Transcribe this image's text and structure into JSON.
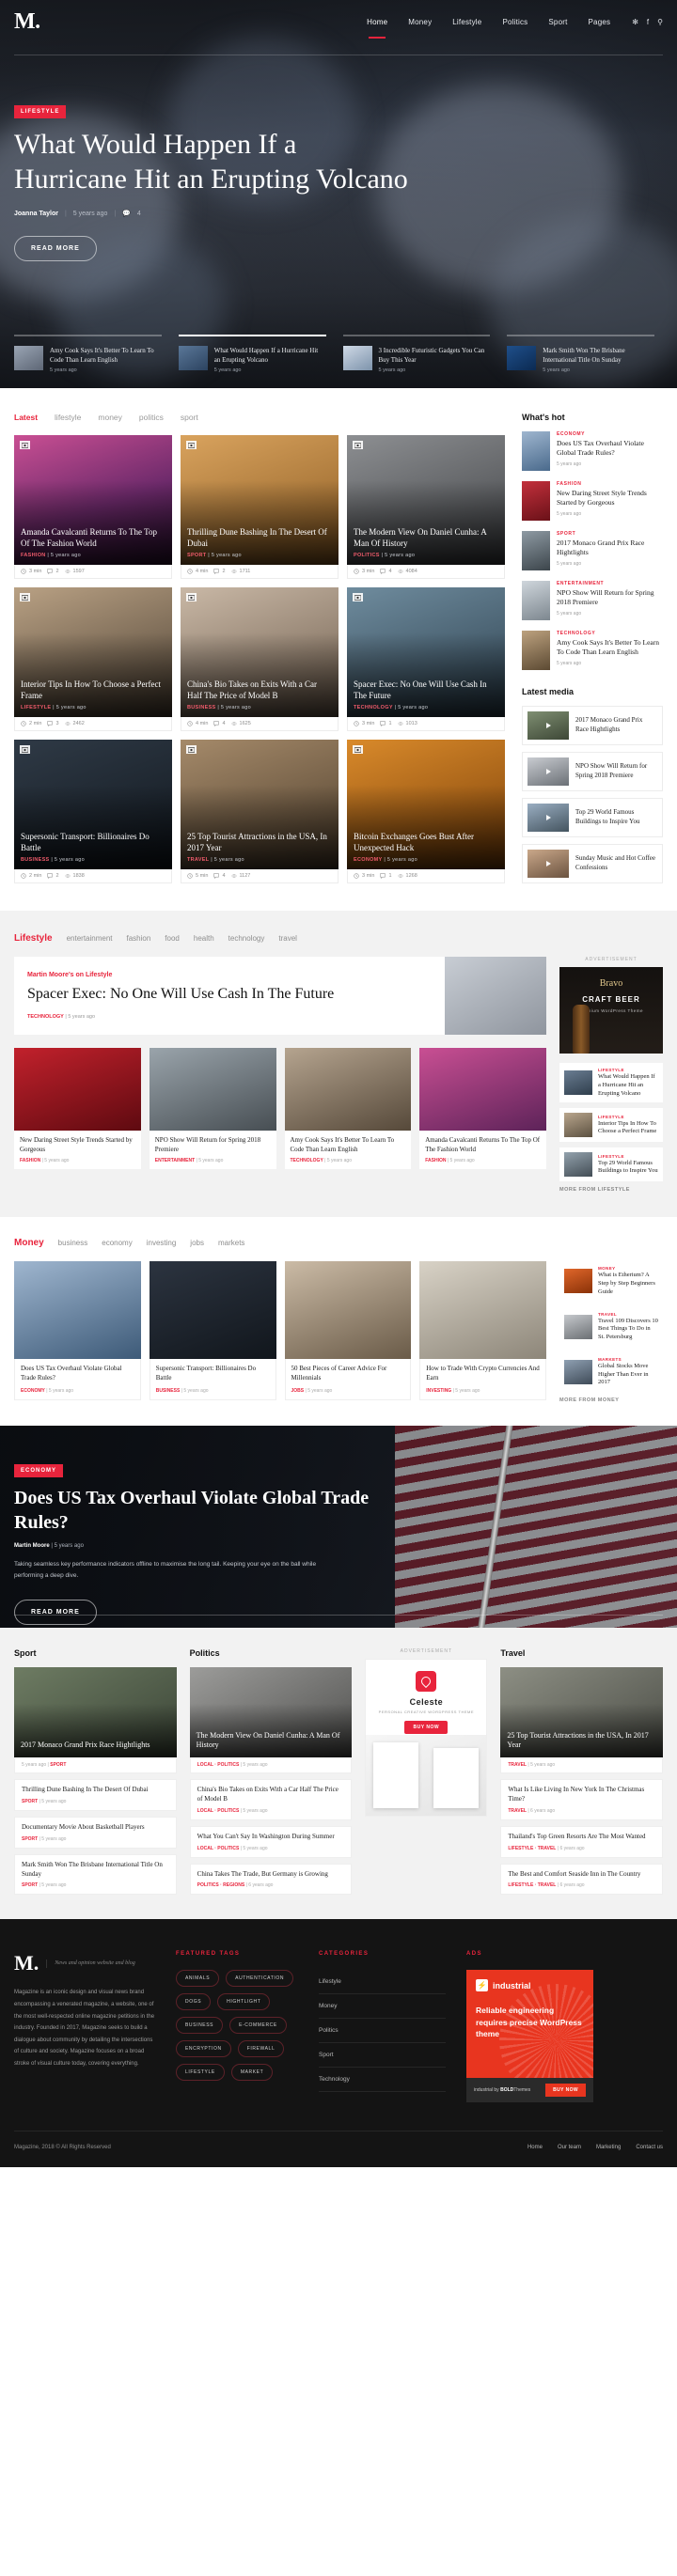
{
  "site": {
    "logo": "M.",
    "nav": [
      {
        "label": "Home",
        "active": true
      },
      {
        "label": "Money",
        "active": false
      },
      {
        "label": "Lifestyle",
        "active": false
      },
      {
        "label": "Politics",
        "active": false
      },
      {
        "label": "Sport",
        "active": false
      },
      {
        "label": "Pages",
        "active": false
      }
    ],
    "icons": [
      "twitter-icon",
      "facebook-icon",
      "search-icon"
    ],
    "accent": "#e8243c"
  },
  "hero": {
    "category": "LIFESTYLE",
    "title": "What Would Happen If a Hurricane Hit an Erupting Volcano",
    "author": "Joanna Taylor",
    "time": "5 years ago",
    "comments": "4",
    "cta": "READ MORE",
    "strip": [
      {
        "title": "Amy Cook Says It's Better To Learn To Code Than Learn English",
        "time": "5 years ago",
        "active": false
      },
      {
        "title": "What Would Happen If a Hurricane Hit an Erupting Volcano",
        "time": "5 years ago",
        "active": true
      },
      {
        "title": "3 Incredible Futuristic Gadgets You Can Buy This Year",
        "time": "5 years ago",
        "active": false
      },
      {
        "title": "Mark Smith Won The Brisbane International Title On Sunday",
        "time": "5 years ago",
        "active": false
      }
    ]
  },
  "latest": {
    "tabs": [
      {
        "label": "Latest",
        "active": true
      },
      {
        "label": "lifestyle",
        "active": false
      },
      {
        "label": "money",
        "active": false
      },
      {
        "label": "politics",
        "active": false
      },
      {
        "label": "sport",
        "active": false
      }
    ],
    "cards": [
      {
        "title": "Amanda Cavalcanti Returns To The Top Of The Fashion World",
        "cat": "FASHION",
        "time": "5 years ago",
        "read": "3 min",
        "comments": "2",
        "views": "1597"
      },
      {
        "title": "Thrilling Dune Bashing In The Desert Of Dubai",
        "cat": "SPORT",
        "time": "5 years ago",
        "read": "4 min",
        "comments": "2",
        "views": "1711"
      },
      {
        "title": "The Modern View On Daniel Cunha: A Man Of History",
        "cat": "POLITICS",
        "time": "5 years ago",
        "read": "3 min",
        "comments": "4",
        "views": "4084"
      },
      {
        "title": "Interior Tips In How To Choose a Perfect Frame",
        "cat": "LIFESTYLE",
        "time": "5 years ago",
        "read": "2 min",
        "comments": "3",
        "views": "2462"
      },
      {
        "title": "China's Bio Takes on Exits With a Car Half The Price of Model B",
        "cat": "BUSINESS",
        "time": "5 years ago",
        "read": "4 min",
        "comments": "4",
        "views": "1625"
      },
      {
        "title": "Spacer Exec: No One Will Use Cash In The Future",
        "cat": "TECHNOLOGY",
        "time": "5 years ago",
        "read": "3 min",
        "comments": "1",
        "views": "1013"
      },
      {
        "title": "Supersonic Transport: Billionaires Do Battle",
        "cat": "BUSINESS",
        "time": "5 years ago",
        "read": "2 min",
        "comments": "2",
        "views": "1838"
      },
      {
        "title": "25 Top Tourist Attractions in the USA, In 2017 Year",
        "cat": "TRAVEL",
        "time": "5 years ago",
        "read": "5 min",
        "comments": "4",
        "views": "1127"
      },
      {
        "title": "Bitcoin Exchanges Goes Bust After Unexpected Hack",
        "cat": "ECONOMY",
        "time": "5 years ago",
        "read": "3 min",
        "comments": "1",
        "views": "1268"
      }
    ],
    "whats_hot_title": "What's hot",
    "whats_hot": [
      {
        "cat": "ECONOMY",
        "title": "Does US Tax Overhaul Violate Global Trade Rules?",
        "time": "5 years ago"
      },
      {
        "cat": "FASHION",
        "title": "New Daring Street Style Trends Started by Gorgeous",
        "time": "5 years ago"
      },
      {
        "cat": "SPORT",
        "title": "2017 Monaco Grand Prix Race Hightlights",
        "time": "5 years ago"
      },
      {
        "cat": "ENTERTAINMENT",
        "title": "NPO Show Will Return for Spring 2018 Premiere",
        "time": "5 years ago"
      },
      {
        "cat": "TECHNOLOGY",
        "title": "Amy Cook Says It's Better To Learn To Code Than Learn English",
        "time": "5 years ago"
      }
    ],
    "latest_media_title": "Latest media",
    "latest_media": [
      {
        "title": "2017 Monaco Grand Prix Race Hightlights"
      },
      {
        "title": "NPO Show Will Return for Spring 2018 Premiere"
      },
      {
        "title": "Top 29 World Famous Buildings to Inspire You"
      },
      {
        "title": "Sunday Music and Hot Coffee Confessions"
      }
    ]
  },
  "lifestyle": {
    "section": "Lifestyle",
    "tabs": [
      "entertainment",
      "fashion",
      "food",
      "health",
      "technology",
      "travel"
    ],
    "feature": {
      "kicker": "Martin Moore's on Lifestyle",
      "title": "Spacer Exec: No One Will Use Cash In The Future",
      "cat": "TECHNOLOGY",
      "time": "5 years ago"
    },
    "ad_label": "ADVERTISEMENT",
    "ad": {
      "brand": "Bravo",
      "line1": "CRAFT BEER",
      "line2": "Premium WordPress Theme"
    },
    "minis": [
      {
        "title": "New Daring Street Style Trends Started by Gorgeous",
        "cat": "FASHION",
        "time": "5 years ago"
      },
      {
        "title": "NPO Show Will Return for Spring 2018 Premiere",
        "cat": "ENTERTAINMENT",
        "time": "5 years ago"
      },
      {
        "title": "Amy Cook Says It's Better To Learn To Code Than Learn English",
        "cat": "TECHNOLOGY",
        "time": "5 years ago"
      },
      {
        "title": "Amanda Cavalcanti Returns To The Top Of The Fashion World",
        "cat": "FASHION",
        "time": "5 years ago"
      }
    ],
    "side": [
      {
        "cat": "LIFESTYLE",
        "title": "What Would Happen If a Hurricane Hit an Erupting Volcano"
      },
      {
        "cat": "LIFESTYLE",
        "title": "Interior Tips In How To Choose a Perfect Frame"
      },
      {
        "cat": "LIFESTYLE",
        "title": "Top 29 World Famous Buildings to Inspire You"
      }
    ],
    "more": "MORE FROM LIFESTYLE"
  },
  "money": {
    "section": "Money",
    "tabs": [
      "business",
      "economy",
      "investing",
      "jobs",
      "markets"
    ],
    "cards": [
      {
        "title": "Does US Tax Overhaul Violate Global Trade Rules?",
        "cat": "ECONOMY",
        "time": "5 years ago"
      },
      {
        "title": "Supersonic Transport: Billionaires Do Battle",
        "cat": "BUSINESS",
        "time": "5 years ago"
      },
      {
        "title": "50 Best Pieces of Career Advice For Millennials",
        "cat": "JOBS",
        "time": "5 years ago"
      },
      {
        "title": "How to Trade With Crypto Currencies And Earn",
        "cat": "INVESTING",
        "time": "5 years ago"
      }
    ],
    "side": [
      {
        "cat": "MONEY",
        "title": "What is Etherium? A Step by Step Beginners Guide"
      },
      {
        "cat": "TRAVEL",
        "title": "Travel 109 Discovers 10 Best Things To Do in St. Petersburg"
      },
      {
        "cat": "MARKETS",
        "title": "Global Stocks Move Higher Than Ever in 2017"
      }
    ],
    "more": "MORE FROM MONEY"
  },
  "dark_feature": {
    "category": "ECONOMY",
    "title": "Does US Tax Overhaul Violate Global Trade Rules?",
    "author": "Martin Moore",
    "time": "5 years ago",
    "excerpt": "Taking seamless key performance indicators offline to maximise the long tail. Keeping your eye on the ball while performing a deep dive.",
    "cta": "READ MORE"
  },
  "bottom": {
    "sport": {
      "title": "Sport",
      "lead": {
        "title": "2017 Monaco Grand Prix Race Hightlights",
        "cat": "SPORT",
        "time": "5 years ago"
      },
      "items": [
        {
          "title": "Thrilling Dune Bashing In The Desert Of Dubai",
          "cat": "SPORT",
          "time": "5 years ago"
        },
        {
          "title": "Documentary Movie About Basketball Players",
          "cat": "SPORT",
          "time": "5 years ago"
        },
        {
          "title": "Mark Smith Won The Brisbane International Title On Sunday",
          "cat": "SPORT",
          "time": "5 years ago"
        }
      ]
    },
    "politics": {
      "title": "Politics",
      "lead": {
        "title": "The Modern View On Daniel Cunha: A Man Of History",
        "cat": "LOCAL · POLITICS",
        "time": "5 years ago"
      },
      "items": [
        {
          "title": "China's Bio Takes on Exits With a Car Half The Price of Model B",
          "cat": "LOCAL · POLITICS",
          "time": "5 years ago"
        },
        {
          "title": "What You Can't Say In Washington During Summer",
          "cat": "LOCAL · POLITICS",
          "time": "5 years ago"
        },
        {
          "title": "China Takes The Trade, But Germany is Growing",
          "cat": "POLITICS · REGIONS",
          "time": "6 years ago"
        }
      ]
    },
    "ads": {
      "label": "ADVERTISEMENT",
      "brand": "Celeste",
      "sub": "PERSONAL CREATIVE WORDPRESS THEME",
      "button": "BUY NOW"
    },
    "travel": {
      "title": "Travel",
      "lead": {
        "title": "25 Top Tourist Attractions in the USA, In 2017 Year",
        "cat": "TRAVEL",
        "time": "5 years ago"
      },
      "items": [
        {
          "title": "What Is Like Living In New York In The Christmas Time?",
          "cat": "TRAVEL",
          "time": "6 years ago"
        },
        {
          "title": "Thailand's Top Green Resorts Are The Most Wanted",
          "cat": "LIFESTYLE · TRAVEL",
          "time": "6 years ago"
        },
        {
          "title": "The Best and Comfort Seaside Inn in The Country",
          "cat": "LIFESTYLE · TRAVEL",
          "time": "6 years ago"
        }
      ]
    }
  },
  "footer": {
    "logo": "M.",
    "logo_sub": "News and opinion website and blog",
    "about": "Magazine is an iconic design and visual news brand encompassing a venerated magazine, a website, one of the most well-respected online magazine petitions in the industry. Founded in 2017, Magazine seeks to build a dialogue about community by detailing the intersections of culture and society. Magazine focuses on a broad stroke of visual culture today, covering everything.",
    "tags_title": "FEATURED TAGS",
    "tags": [
      "ANIMALS",
      "AUTHENTICATION",
      "DOGS",
      "HIGHTLIGHT",
      "BUSINESS",
      "E-COMMERCE",
      "ENCRYPTION",
      "FIREWALL",
      "LIFESTYLE",
      "MARKET"
    ],
    "cats_title": "CATEGORIES",
    "cats": [
      "Lifestyle",
      "Money",
      "Politics",
      "Sport",
      "Technology"
    ],
    "ads_title": "ADS",
    "ad": {
      "brand": "industrial",
      "copy": "Reliable engineering requires precise WordPress theme",
      "by_prefix": "industrial by ",
      "by_bold": "BOLD",
      "by_suffix": "Themes",
      "button": "BUY NOW"
    },
    "copyright": "Magazine, 2018 © All Rights Reserved",
    "links": [
      "Home",
      "Our team",
      "Marketing",
      "Contact us"
    ]
  }
}
